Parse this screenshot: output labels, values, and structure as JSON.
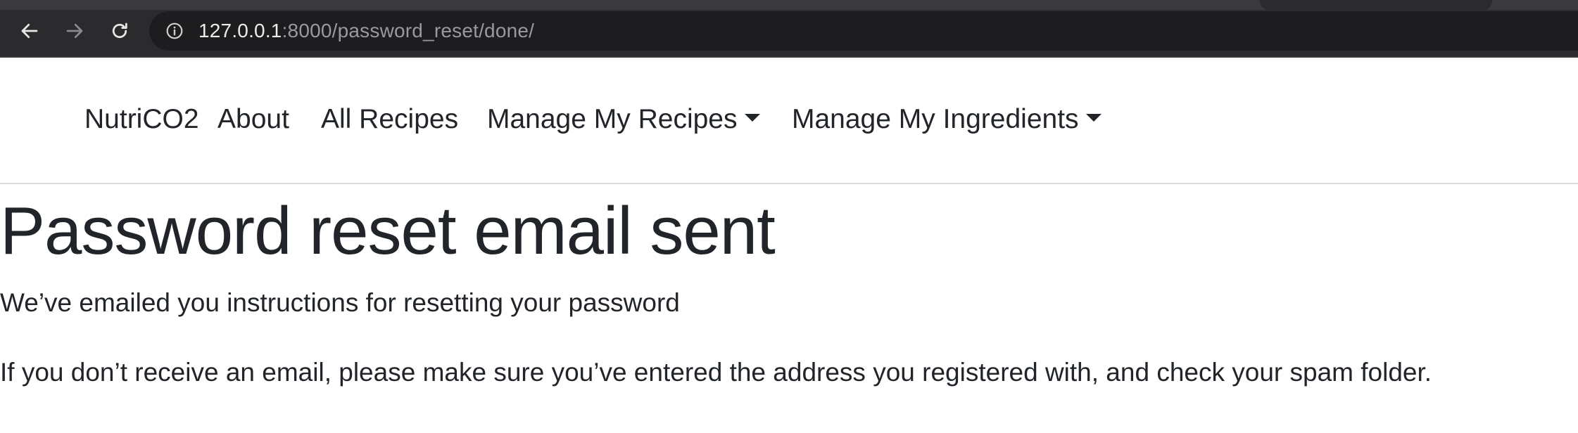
{
  "browser": {
    "url_host": "127.0.0.1",
    "url_rest": ":8000/password_reset/done/",
    "icons": {
      "back": "arrow-left-icon",
      "forward": "arrow-right-icon",
      "reload": "reload-icon",
      "site_info": "info-icon"
    }
  },
  "navbar": {
    "brand": "NutriCO2",
    "items": [
      {
        "label": "About"
      },
      {
        "label": "All Recipes"
      },
      {
        "label": "Manage My Recipes",
        "dropdown": true
      },
      {
        "label": "Manage My Ingredients",
        "dropdown": true
      }
    ]
  },
  "main": {
    "title": "Password reset email sent",
    "paragraphs": [
      "We’ve emailed you instructions for resetting your password",
      "If you don’t receive an email, please make sure you’ve entered the address you registered with, and check your spam folder."
    ]
  },
  "colors": {
    "chrome_bg": "#2b2b2e",
    "omnibox_bg": "#1d1d20",
    "text": "#212529",
    "url_muted": "#9a9a9e"
  }
}
